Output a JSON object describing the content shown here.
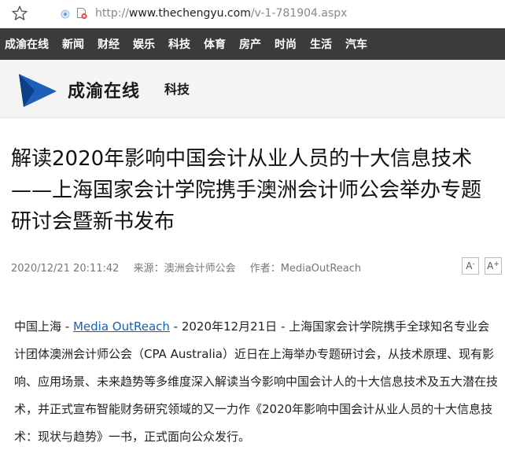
{
  "address_bar": {
    "scheme": "http://",
    "host": "www.thechengyu.com",
    "path": "/v-1-781904.aspx"
  },
  "nav": {
    "items": [
      "成渝在线",
      "新闻",
      "财经",
      "娱乐",
      "科技",
      "体育",
      "房产",
      "时尚",
      "生活",
      "汽车"
    ]
  },
  "brand": {
    "name": "成渝在线",
    "section": "科技",
    "logo_color": "#1e5fb8"
  },
  "article": {
    "title": "解读2020年影响中国会计从业人员的十大信息技术 ——上海国家会计学院携手澳洲会计师公会举办专题研讨会暨新书发布",
    "date": "2020/12/21 20:11:42",
    "source": "来源：澳洲会计师公会",
    "author": "作者：MediaOutReach",
    "font_smaller": "A",
    "font_larger": "A",
    "body_prefix": "中国上海 - ",
    "body_link": "Media OutReach",
    "body_rest": " - 2020年12月21日 - 上海国家会计学院携手全球知名专业会计团体澳洲会计师公会（CPA Australia）近日在上海举办专题研讨会，从技术原理、现有影响、应用场景、未来趋势等多维度深入解读当今影响中国会计人的十大信息技术及五大潜在技术，并正式宣布智能财务研究领域的又一力作《2020年影响中国会计从业人员的十大信息技术：现状与趋势》一书，正式面向公众发行。"
  }
}
